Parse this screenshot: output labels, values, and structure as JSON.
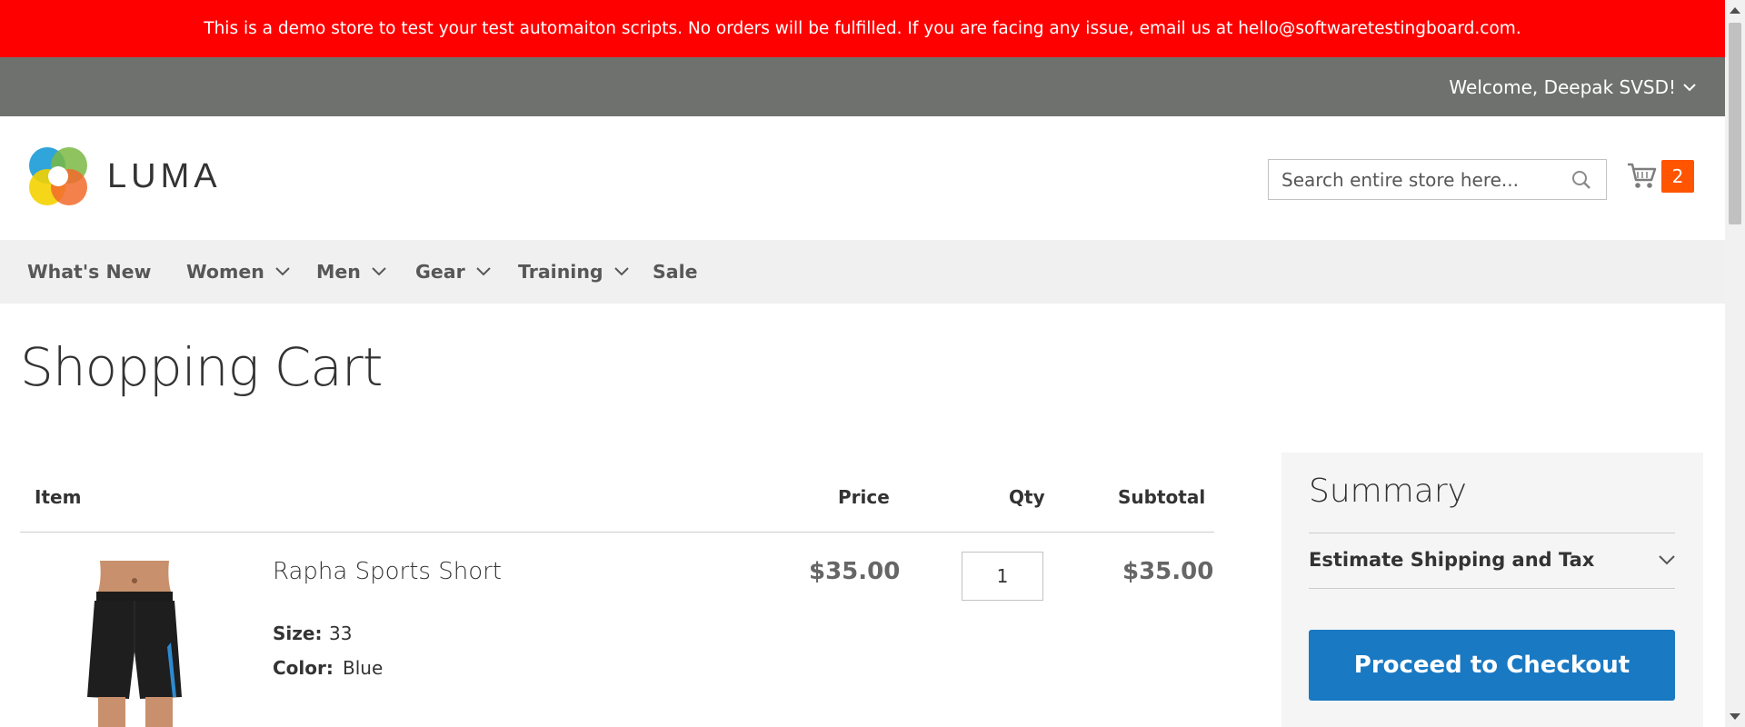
{
  "banner": {
    "text": "This is a demo store to test your test automaiton scripts. No orders will be fulfilled. If you are facing any issue, email us at hello@softwaretestingboard.com.",
    "color": "#ff0000"
  },
  "top_bar": {
    "welcome": "Welcome, Deepak SVSD!"
  },
  "header": {
    "logo_text": "LUMA",
    "search_placeholder": "Search entire store here...",
    "cart_count": "2",
    "cart_badge_color": "#ff5501"
  },
  "nav": {
    "items": [
      {
        "label": "What's New",
        "has_dropdown": false
      },
      {
        "label": "Women",
        "has_dropdown": true
      },
      {
        "label": "Men",
        "has_dropdown": true
      },
      {
        "label": "Gear",
        "has_dropdown": true
      },
      {
        "label": "Training",
        "has_dropdown": true
      },
      {
        "label": "Sale",
        "has_dropdown": false
      }
    ]
  },
  "page": {
    "title": "Shopping Cart"
  },
  "cart_table": {
    "headers": {
      "item": "Item",
      "price": "Price",
      "qty": "Qty",
      "subtotal": "Subtotal"
    },
    "rows": [
      {
        "name": "Rapha Sports Short",
        "price": "$35.00",
        "qty": "1",
        "subtotal": "$35.00",
        "options": [
          {
            "label": "Size:",
            "value": "33"
          },
          {
            "label": "Color:",
            "value": "Blue"
          }
        ]
      }
    ]
  },
  "summary": {
    "title": "Summary",
    "estimate_label": "Estimate Shipping and Tax",
    "checkout_label": "Proceed to Checkout",
    "checkout_color": "#1979c3"
  }
}
